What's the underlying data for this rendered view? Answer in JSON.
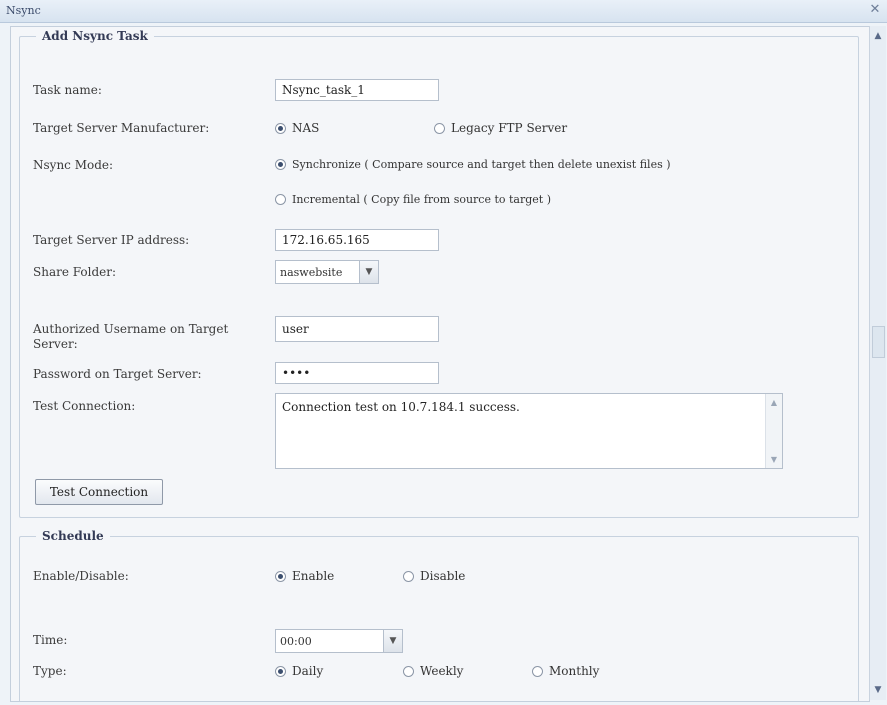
{
  "window": {
    "title": "Nsync",
    "close_glyph": "✕"
  },
  "add_task": {
    "legend": "Add Nsync Task",
    "task_name_label": "Task name:",
    "task_name_value": "Nsync_task_1",
    "manufacturer_label": "Target Server Manufacturer:",
    "manufacturer_options": [
      {
        "label": "NAS",
        "checked": true
      },
      {
        "label": "Legacy FTP Server",
        "checked": false
      }
    ],
    "mode_label": "Nsync Mode:",
    "mode_options": [
      {
        "label": "Synchronize ( Compare source and target then delete unexist files )",
        "checked": true
      },
      {
        "label": "Incremental ( Copy file from source to target )",
        "checked": false
      }
    ],
    "ip_label": "Target Server IP address:",
    "ip_value": "172.16.65.165",
    "share_label": "Share Folder:",
    "share_value": "naswebsite",
    "username_label": "Authorized Username on Target Server:",
    "username_value": "user",
    "password_label": "Password on Target Server:",
    "password_value": "••••",
    "test_label": "Test Connection:",
    "test_result": "Connection test on 10.7.184.1 success.",
    "test_button": "Test Connection"
  },
  "schedule": {
    "legend": "Schedule",
    "enable_label": "Enable/Disable:",
    "enable_options": [
      {
        "label": "Enable",
        "checked": true
      },
      {
        "label": "Disable",
        "checked": false
      }
    ],
    "time_label": "Time:",
    "time_value": "00:00",
    "type_label": "Type:",
    "type_options": [
      {
        "label": "Daily",
        "checked": true
      },
      {
        "label": "Weekly",
        "checked": false
      },
      {
        "label": "Monthly",
        "checked": false
      }
    ]
  },
  "icons": {
    "dropdown": "▼",
    "scroll_up": "▲",
    "scroll_down": "▼"
  }
}
